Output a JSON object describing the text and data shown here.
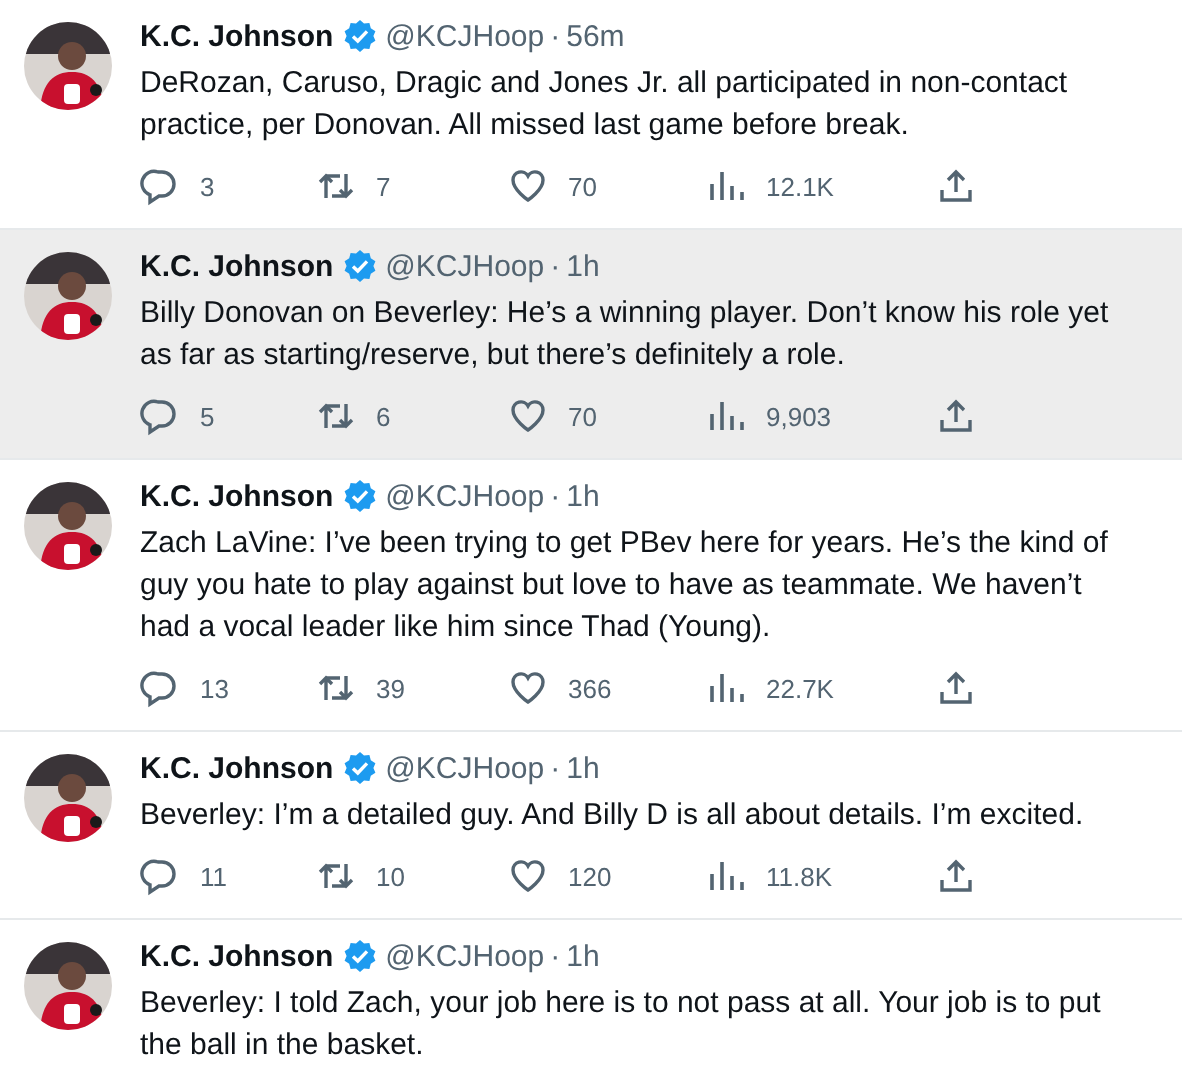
{
  "separator": "·",
  "tweets": [
    {
      "author": "K.C. Johnson",
      "handle": "@KCJHoop",
      "time": "56m",
      "highlighted": false,
      "text": "DeRozan, Caruso, Dragic and Jones Jr. all participated in non-contact practice, per Donovan. All missed last game before break.",
      "replies": "3",
      "retweets": "7",
      "likes": "70",
      "views": "12.1K"
    },
    {
      "author": "K.C. Johnson",
      "handle": "@KCJHoop",
      "time": "1h",
      "highlighted": true,
      "text": "Billy Donovan on Beverley: He’s a winning player. Don’t know his role yet as far as starting/reserve, but there’s definitely a role.",
      "replies": "5",
      "retweets": "6",
      "likes": "70",
      "views": "9,903"
    },
    {
      "author": "K.C. Johnson",
      "handle": "@KCJHoop",
      "time": "1h",
      "highlighted": false,
      "text": "Zach LaVine: I’ve been trying to get PBev here for years. He’s the kind of guy you hate to play against but love to have as teammate. We haven’t had a vocal leader like him since Thad (Young).",
      "replies": "13",
      "retweets": "39",
      "likes": "366",
      "views": "22.7K"
    },
    {
      "author": "K.C. Johnson",
      "handle": "@KCJHoop",
      "time": "1h",
      "highlighted": false,
      "text": "Beverley: I’m a detailed guy. And Billy D is all about details. I’m excited.",
      "replies": "11",
      "retweets": "10",
      "likes": "120",
      "views": "11.8K"
    },
    {
      "author": "K.C. Johnson",
      "handle": "@KCJHoop",
      "time": "1h",
      "highlighted": false,
      "text": "Beverley: I told Zach, your job here is to not pass at all. Your job is to put the ball in the basket."
    }
  ]
}
